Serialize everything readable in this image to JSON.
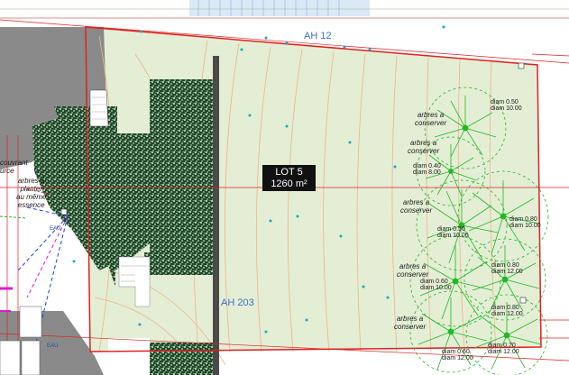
{
  "lot": {
    "name": "LOT 5",
    "area": "1260 m²"
  },
  "parcels": {
    "north": "AH 12",
    "south": "AH 203"
  },
  "tree_annotations": [
    {
      "note": "arbres a\nconserver",
      "dims": [
        "diam 0.50",
        "diam 10.00"
      ]
    },
    {
      "note": "arbres a\nconserver",
      "dims": [
        "diam 0.40",
        "diam 8.00"
      ]
    },
    {
      "note": "arbres a\nconserver",
      "dims": [
        "diam 0.50",
        "diam 10.00"
      ]
    },
    {
      "note": "arbres a\nconserver",
      "dims": [
        "diam 0.60",
        "diam 10.00"
      ]
    },
    {
      "note": "arbres a\nconserver",
      "dims": [
        "diam 0.60",
        "diam 12.00"
      ]
    }
  ],
  "extra_dims": [
    [
      "diam 0.80",
      "diam 10.00"
    ],
    [
      "diam 0.80",
      "diam 12.00"
    ],
    [
      "diam 0.80",
      "diam 12.00"
    ],
    [
      "diam 0.70",
      "diam 12.00"
    ]
  ],
  "left_notes": {
    "top": "couvrant\nurce",
    "middle": "arbres a\nplanter\nau même\nessence"
  },
  "utility": {
    "water": "EAU"
  },
  "colors": {
    "lot_fill": "#e3eed5",
    "boundary": "#e02020",
    "contour": "#f0b48a",
    "tree": "#22b822",
    "paving": "#1f4a2a",
    "building_gray": "#8a8a8a",
    "parcel_text": "#3c6fc4"
  }
}
